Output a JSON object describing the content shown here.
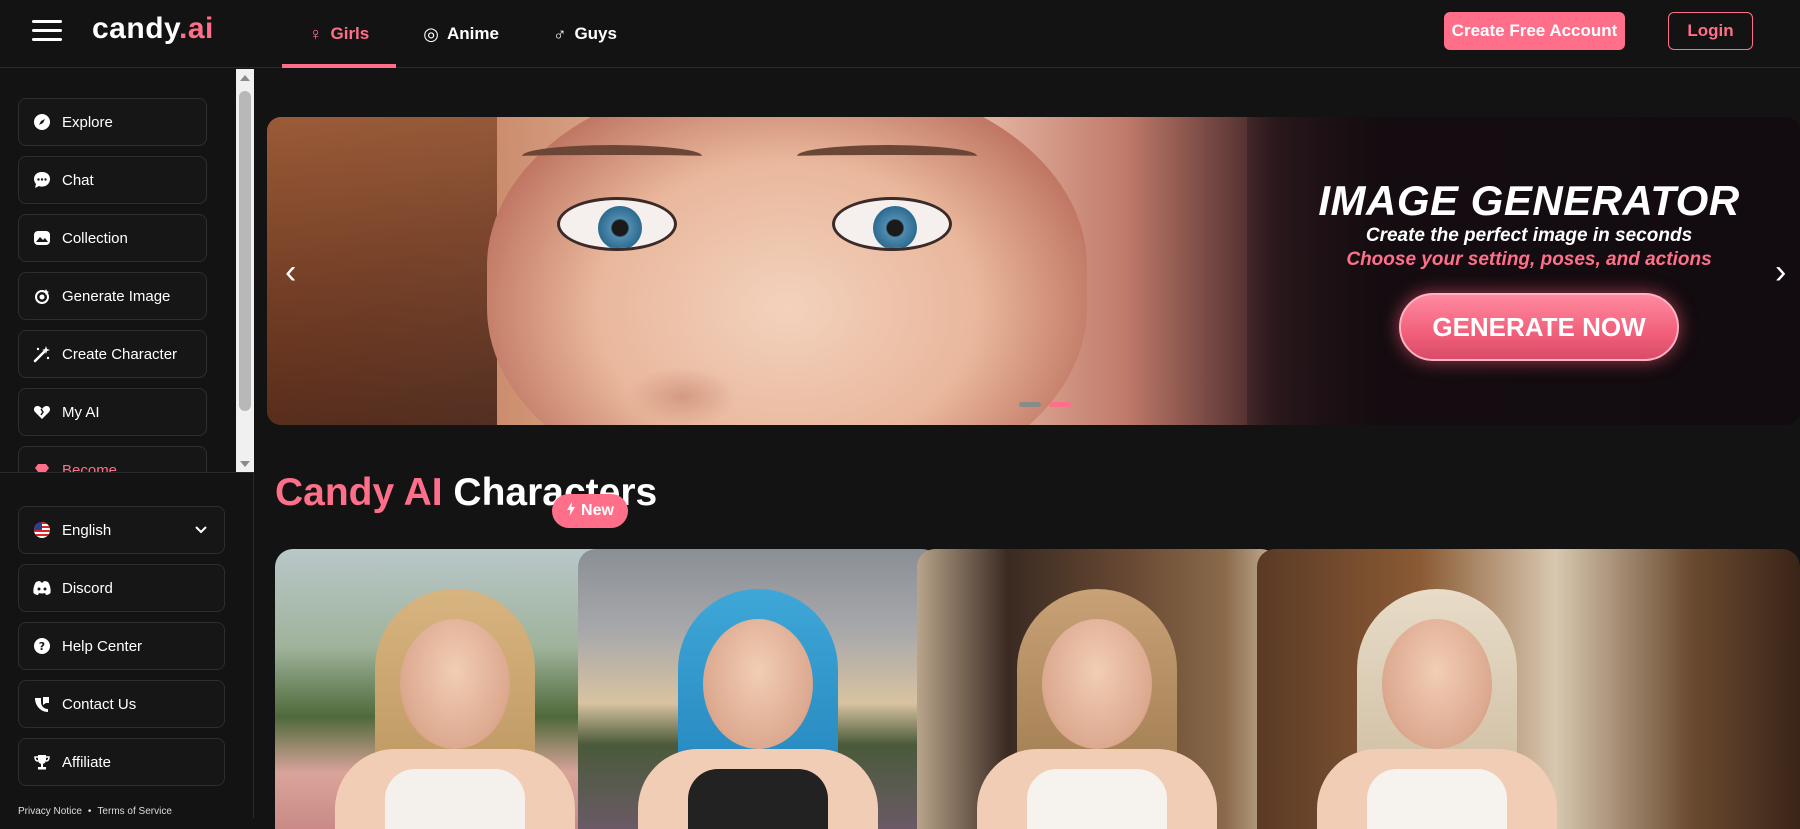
{
  "header": {
    "logo_main": "candy",
    "logo_accent": ".ai",
    "tabs": [
      {
        "label": "Girls",
        "icon": "female-icon",
        "glyph": "♀"
      },
      {
        "label": "Anime",
        "icon": "anime-swirl-icon",
        "glyph": "◎"
      },
      {
        "label": "Guys",
        "icon": "male-icon",
        "glyph": "♂"
      }
    ],
    "create_account": "Create Free Account",
    "login": "Login"
  },
  "sidebar": {
    "items": [
      {
        "label": "Explore",
        "icon": "compass-icon"
      },
      {
        "label": "Chat",
        "icon": "chat-bubble-icon"
      },
      {
        "label": "Collection",
        "icon": "collection-icon"
      },
      {
        "label": "Generate Image",
        "icon": "generate-image-icon"
      },
      {
        "label": "Create Character",
        "icon": "magic-wand-icon"
      },
      {
        "label": "My AI",
        "icon": "heart-icon"
      },
      {
        "label": "Become",
        "icon": "diamond-icon"
      }
    ],
    "lower": [
      {
        "label": "English",
        "icon": "us-flag-icon"
      },
      {
        "label": "Discord",
        "icon": "discord-icon"
      },
      {
        "label": "Help Center",
        "icon": "help-icon"
      },
      {
        "label": "Contact Us",
        "icon": "contact-icon"
      },
      {
        "label": "Affiliate",
        "icon": "trophy-icon"
      }
    ],
    "footer": {
      "privacy": "Privacy Notice",
      "sep": "•",
      "terms": "Terms of Service"
    }
  },
  "banner": {
    "title": "IMAGE GENERATOR",
    "subtitle1": "Create the perfect image in seconds",
    "subtitle2": "Choose your setting, poses, and actions",
    "cta": "GENERATE NOW",
    "active_slide": 2,
    "slide_count": 2
  },
  "section": {
    "title_accent": "Candy AI",
    "title_rest": " Characters"
  },
  "cards": [
    {
      "badge": "New"
    },
    {},
    {},
    {}
  ],
  "colors": {
    "accent": "#ff6f8a",
    "background": "#131313"
  }
}
